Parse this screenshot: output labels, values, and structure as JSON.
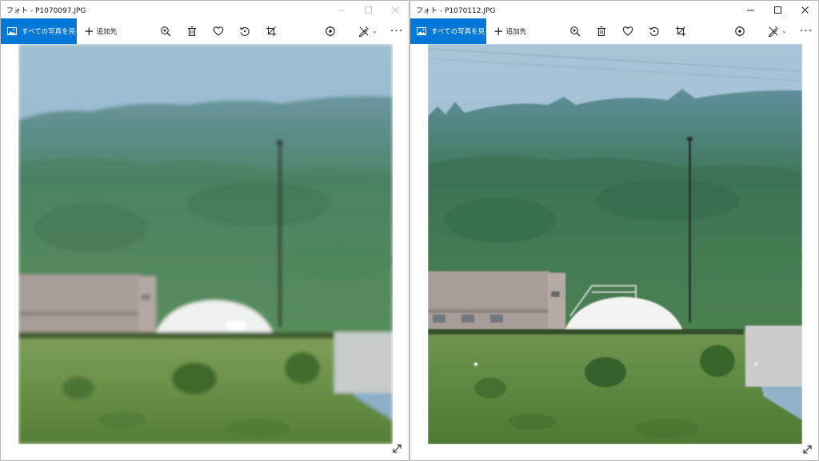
{
  "windows": [
    {
      "title": "フォト - P1070097.JPG",
      "all_photos_label": "すべての写真を見る",
      "add_to_label": "追加先",
      "controls_inactive": true
    },
    {
      "title": "フォト - P1070112.JPG",
      "all_photos_label": "すべての写真を見る",
      "add_to_label": "追加先",
      "controls_inactive": false
    }
  ],
  "icons": {
    "all_photos": "photos-icon",
    "zoom": "zoom-in-icon",
    "delete": "trash-icon",
    "favorite": "heart-icon",
    "rotate": "rotate-icon",
    "crop": "crop-icon",
    "enhance": "enhance-icon",
    "edit": "edit-draw-icon",
    "more": "more-icon",
    "expand": "expand-icon"
  },
  "colors": {
    "accent": "#0078d7",
    "sky": "#a9c3d6",
    "forest": "#4f7f5a",
    "grass": "#5e8a3e",
    "dome": "#f2f4f2",
    "building": "#a59a94"
  }
}
